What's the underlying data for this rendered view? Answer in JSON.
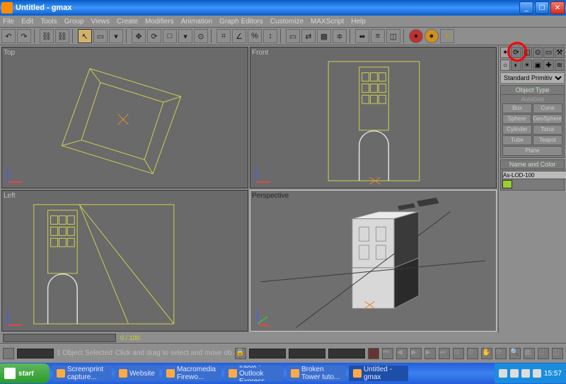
{
  "window": {
    "title": "Untitled - gmax",
    "minimize": "_",
    "maximize": "☐",
    "close": "✕"
  },
  "menu": [
    "File",
    "Edit",
    "Tools",
    "Group",
    "Views",
    "Create",
    "Modifiers",
    "Animation",
    "Graph Editors",
    "Customize",
    "MAXScript",
    "Help"
  ],
  "viewports": {
    "top": "Top",
    "front": "Front",
    "left": "Left",
    "perspective": "Perspective"
  },
  "sidepanel": {
    "dropdown": "Standard Primitives",
    "rollout_objtype": "Object Type",
    "autogrid": "AutoGrid",
    "buttons": [
      "Box",
      "Cone",
      "Sphere",
      "GeoSphere",
      "Cylinder",
      "Torus",
      "Tube",
      "Teapot",
      "Plane"
    ],
    "rollout_name": "Name and Color",
    "name_field": "As-LOD-100"
  },
  "timeslider": {
    "frame": "0 / 100"
  },
  "status": {
    "prompt": "Click and drag to select and move objects",
    "selinfo": "1 Object Selected"
  },
  "taskbar": {
    "start": "start",
    "items": [
      "Screenprint capture...",
      "Website",
      "Macromedia Firewo...",
      "Inbox - Outlook Express",
      "Broken Tower tuto...",
      "Untitled - gmax"
    ],
    "clock": "15:57"
  }
}
